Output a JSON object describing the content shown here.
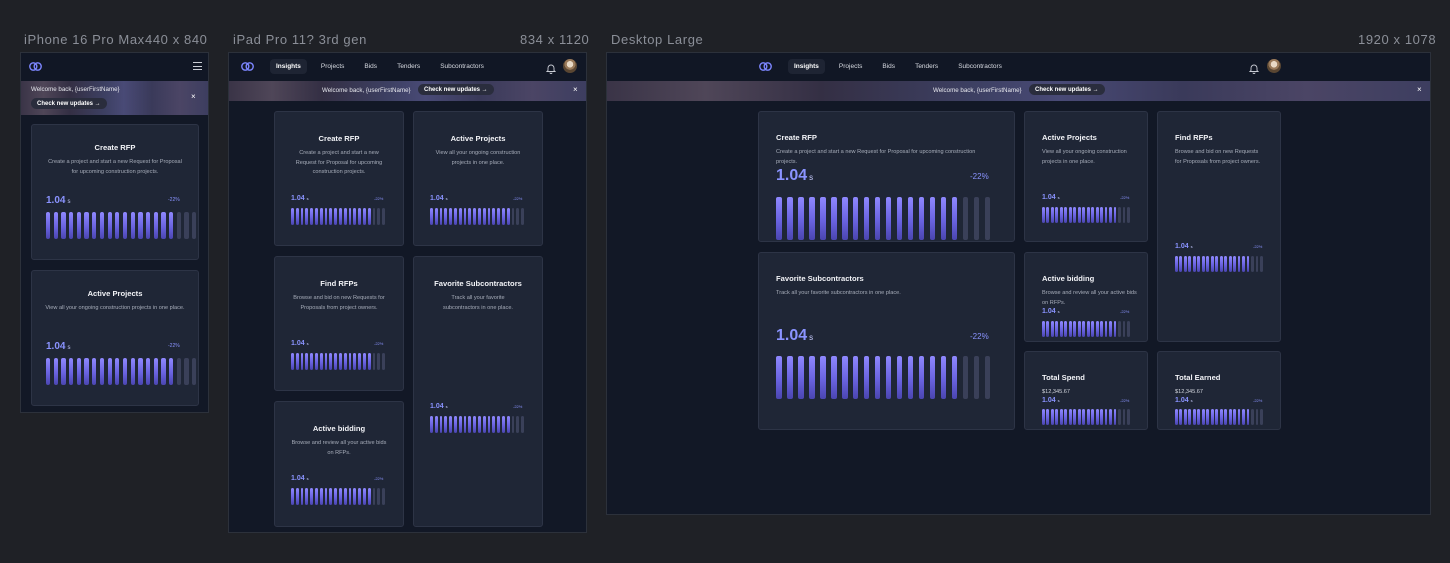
{
  "frames": {
    "phone": {
      "name": "iPhone 16 Pro Max",
      "size": "440 x 840"
    },
    "tablet": {
      "name": "iPad Pro 11? 3rd gen",
      "size": "834 x 1120"
    },
    "desktop": {
      "name": "Desktop Large",
      "size": "1920 x 1078"
    }
  },
  "nav": {
    "items": [
      "Insights",
      "Projects",
      "Bids",
      "Tenders",
      "Subcontractors"
    ],
    "active_index": 0
  },
  "banner": {
    "welcome": "Welcome back, {userFirstName}",
    "cta": "Check new updates →",
    "close": "×"
  },
  "cards": {
    "create_rfp": {
      "title": "Create RFP",
      "desc": "Create a project and start a new Request for Proposal for upcoming construction projects."
    },
    "active_projects": {
      "title": "Active Projects",
      "desc_phone": "View all your ongoing construction projects in one place.",
      "desc": "View all your ongoing construction projects in one place."
    },
    "find_rfps": {
      "title": "Find RFPs",
      "desc_tablet": "Browse and bid on new Requests for Proposals from project owners.",
      "desc": "Browse and bid on new Requests for Proposals from project owners."
    },
    "fav_subs": {
      "title": "Favorite Subcontractors",
      "desc_tablet": "Track all your favorite subcontractors in one place.",
      "desc": "Track all your favorite subcontractors in one place."
    },
    "active_bidding": {
      "title": "Active bidding",
      "desc_tablet": "Browse and review all your active bids on RFPs.",
      "desc": "Browse and review all your active bids on RFPs."
    },
    "total_spend": {
      "title": "Total Spend",
      "amount": "$12,345.67"
    },
    "total_earned": {
      "title": "Total Earned",
      "amount": "$12,345.67"
    }
  },
  "metric": {
    "value": "1.04",
    "unit": "s",
    "delta": "-22%"
  },
  "bar_chart": {
    "total": 20,
    "active": 17
  },
  "colors": {
    "accent": "#8a93ff",
    "background": "#121826",
    "card": "#1f2636",
    "canvas": "#1f2126"
  }
}
